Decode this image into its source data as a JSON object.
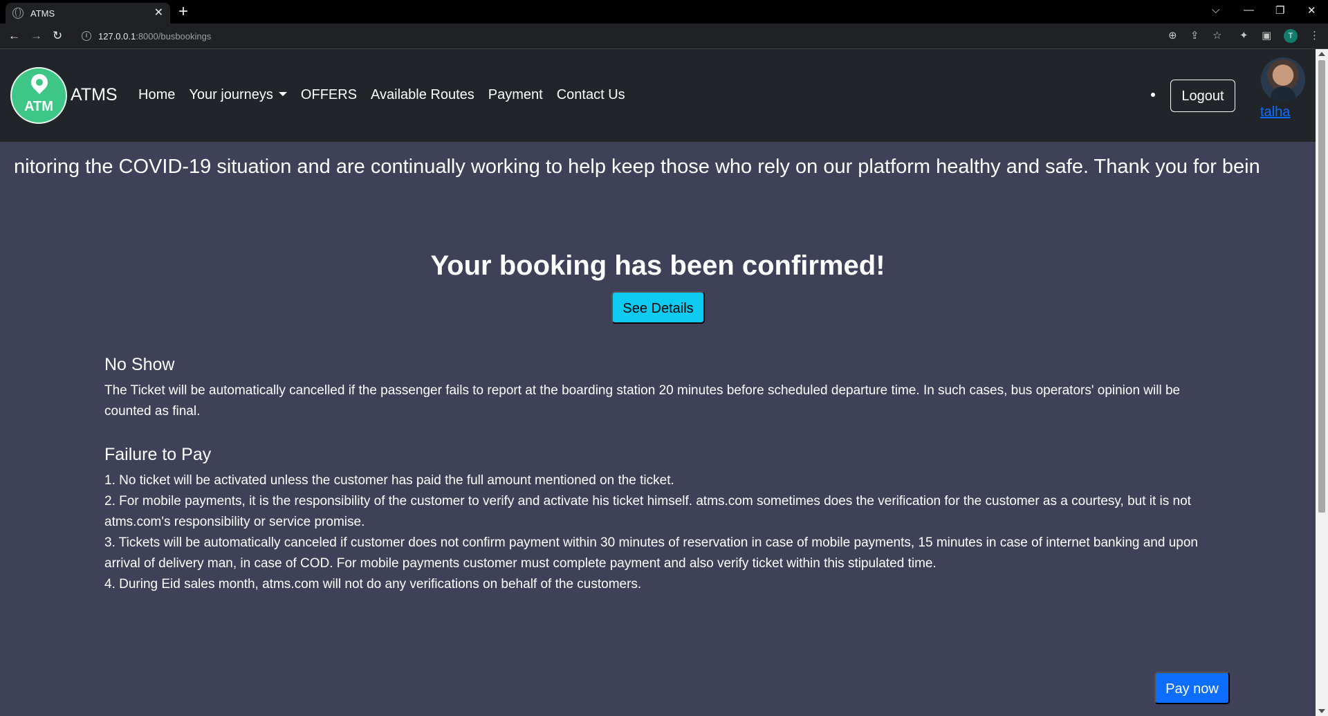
{
  "browser": {
    "tab_title": "ATMS",
    "new_tab": "+",
    "url_host": "127.0.0.1",
    "url_path": ":8000/busbookings",
    "profile_initial": "T"
  },
  "navbar": {
    "brand_logo_text": "ATM",
    "brand_name": "ATMS",
    "links": [
      "Home",
      "Your journeys",
      "OFFERS",
      "Available Routes",
      "Payment",
      "Contact Us"
    ],
    "logout_label": "Logout",
    "username": "talha"
  },
  "marquee": {
    "text": "nitoring the COVID-19 situation and are continually working to help keep those who rely on our platform healthy and safe. Thank you for bein"
  },
  "main": {
    "confirm_title": "Your booking has been confirmed!",
    "details_label": "See Details",
    "no_show": {
      "heading": "No Show",
      "body": "The Ticket will be automatically cancelled if the passenger fails to report at the boarding station 20 minutes before scheduled departure time. In such cases, bus operators' opinion will be counted as final."
    },
    "failure_to_pay": {
      "heading": "Failure to Pay",
      "items": [
        "1. No ticket will be activated unless the customer has paid the full amount mentioned on the ticket.",
        "2. For mobile payments, it is the responsibility of the customer to verify and activate his ticket himself. atms.com sometimes does the verification for the customer as a courtesy, but it is not atms.com's responsibility or service promise.",
        "3. Tickets will be automatically canceled if customer does not confirm payment within 30 minutes of reservation in case of mobile payments, 15 minutes in case of internet banking and upon arrival of delivery man, in case of COD. For mobile payments customer must complete payment and also verify ticket within this stipulated time.",
        "4. During Eid sales month, atms.com will not do any verifications on behalf of the customers."
      ]
    },
    "pay_label": "Pay now"
  },
  "colors": {
    "page_bg": "#3e4158",
    "navbar_bg": "#212529",
    "details_btn": "#0dcaf0",
    "pay_btn": "#0d6efd",
    "logo_green": "#3ec686"
  }
}
